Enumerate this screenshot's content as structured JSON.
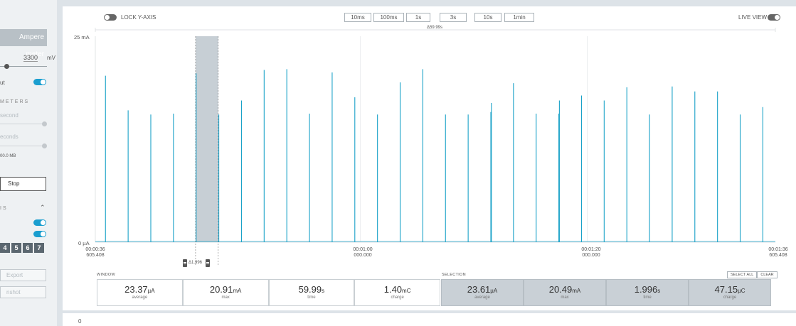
{
  "sidebar": {
    "mode_button": "Ampere meter",
    "voltage_value": "3300",
    "voltage_unit": "mV",
    "output_label": "ut",
    "section_parameters": "METERS",
    "sample_rate_label": "second",
    "duration_label": "econds",
    "buffer_label": "00.0 MB",
    "stop_label": "Stop",
    "section_digital": "IS",
    "digital_channels": [
      "4",
      "5",
      "6",
      "7"
    ],
    "export_label": "Export",
    "screenshot_label": "nshot"
  },
  "topbar": {
    "lock_y_axis": "LOCK Y-AXIS",
    "live_view": "LIVE VIEW",
    "zoom_buttons": [
      "10ms",
      "100ms",
      "1s",
      "3s",
      "10s",
      "1min"
    ],
    "span_label": "Δ59.99s"
  },
  "chart_data": {
    "type": "line",
    "ylabel_top": "25 mA",
    "ylabel_bottom": "0 µA",
    "ylim_mA": [
      0,
      25
    ],
    "x_ticks": [
      {
        "time": "00:00:36",
        "sub": "605.408"
      },
      {
        "time": "00:01:00",
        "sub": "000.000"
      },
      {
        "time": "00:01:20",
        "sub": "000.000"
      },
      {
        "time": "00:01:36",
        "sub": "605.408"
      }
    ],
    "x_range_s": [
      36.605,
      96.605
    ],
    "spikes": [
      {
        "t": 37.5,
        "mA": 20.2
      },
      {
        "t": 39.5,
        "mA": 16.0
      },
      {
        "t": 41.5,
        "mA": 15.5
      },
      {
        "t": 43.5,
        "mA": 15.6
      },
      {
        "t": 45.5,
        "mA": 20.5
      },
      {
        "t": 47.5,
        "mA": 15.5
      },
      {
        "t": 49.5,
        "mA": 17.2
      },
      {
        "t": 51.5,
        "mA": 20.9
      },
      {
        "t": 53.5,
        "mA": 21.0
      },
      {
        "t": 55.5,
        "mA": 15.6
      },
      {
        "t": 57.5,
        "mA": 20.6
      },
      {
        "t": 59.5,
        "mA": 17.6
      },
      {
        "t": 61.5,
        "mA": 15.5
      },
      {
        "t": 63.5,
        "mA": 19.4
      },
      {
        "t": 65.5,
        "mA": 21.0
      },
      {
        "t": 67.5,
        "mA": 15.5
      },
      {
        "t": 69.5,
        "mA": 15.5
      },
      {
        "t": 71.5,
        "mA": 15.8
      },
      {
        "t": 71.55,
        "mA": 16.9
      },
      {
        "t": 73.5,
        "mA": 19.3
      },
      {
        "t": 75.5,
        "mA": 15.6
      },
      {
        "t": 77.5,
        "mA": 15.6
      },
      {
        "t": 77.55,
        "mA": 17.2
      },
      {
        "t": 79.5,
        "mA": 17.8
      },
      {
        "t": 81.5,
        "mA": 17.2
      },
      {
        "t": 83.5,
        "mA": 18.8
      },
      {
        "t": 85.5,
        "mA": 15.5
      },
      {
        "t": 87.5,
        "mA": 18.9
      },
      {
        "t": 89.5,
        "mA": 18.3
      },
      {
        "t": 91.5,
        "mA": 18.3
      },
      {
        "t": 93.5,
        "mA": 15.5
      },
      {
        "t": 95.5,
        "mA": 16.4
      }
    ],
    "selection": {
      "start_s": 45.45,
      "end_s": 47.45
    },
    "grid": true
  },
  "selection_delta": "Δ1.996",
  "window": {
    "title": "WINDOW",
    "stats": [
      {
        "value": "23.37",
        "unit": "µA",
        "label": "average"
      },
      {
        "value": "20.91",
        "unit": "mA",
        "label": "max"
      },
      {
        "value": "59.99",
        "unit": "s",
        "label": "time"
      },
      {
        "value": "1.40",
        "unit": "mC",
        "label": "charge"
      }
    ]
  },
  "selection_stats": {
    "title": "SELECTION",
    "select_all": "SELECT ALL",
    "clear": "CLEAR",
    "stats": [
      {
        "value": "23.61",
        "unit": "µA",
        "label": "average"
      },
      {
        "value": "20.49",
        "unit": "mA",
        "label": "max"
      },
      {
        "value": "1.996",
        "unit": "s",
        "label": "time"
      },
      {
        "value": "47.15",
        "unit": "µC",
        "label": "charge"
      }
    ]
  },
  "bottom_panel": {
    "value": "0"
  },
  "colors": {
    "trace": "#1aa2c8",
    "selection": "#c7cfd5",
    "toggle_on": "#1a9ecf"
  }
}
